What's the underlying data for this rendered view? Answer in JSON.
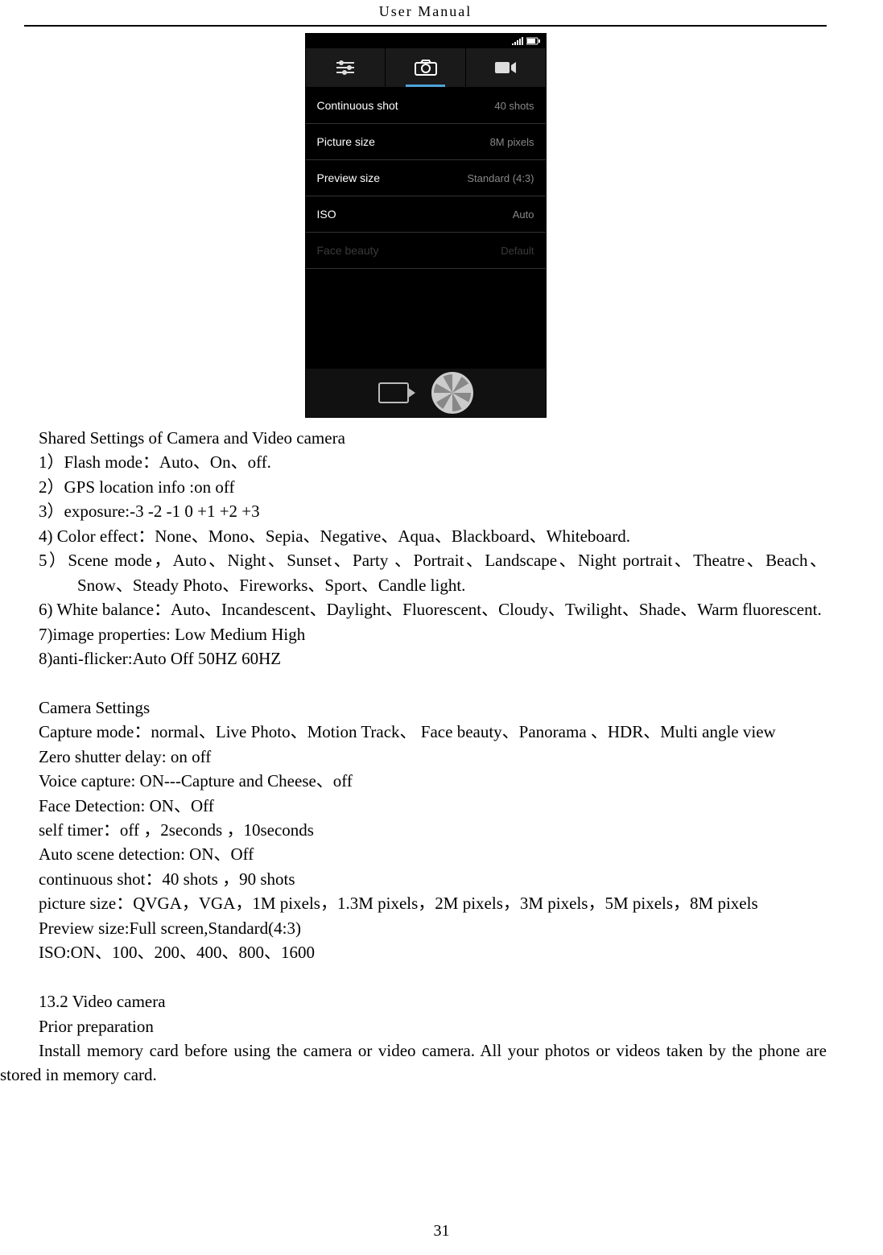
{
  "header": "User    Manual",
  "phone": {
    "tabs": {
      "active_index": 1
    },
    "rows": [
      {
        "label": "Continuous shot",
        "value": "40 shots",
        "faded": false
      },
      {
        "label": "Picture size",
        "value": "8M pixels",
        "faded": false
      },
      {
        "label": "Preview size",
        "value": "Standard (4:3)",
        "faded": false
      },
      {
        "label": "ISO",
        "value": "Auto",
        "faded": false
      },
      {
        "label": "Face beauty",
        "value": "Default",
        "faded": true
      }
    ]
  },
  "content": {
    "l1": "Shared Settings of Camera and Video camera",
    "l2": "1）Flash mode：Auto、On、off.",
    "l3": " 2）GPS location info :on      off",
    "l4": "3）exposure:-3    -2    -1    0    +1    +2    +3",
    "l5": "4)    Color effect：None、Mono、Sepia、Negative、Aqua、Blackboard、Whiteboard.",
    "l6": "5）Scene mode，Auto、Night、Sunset、Party 、Portrait、Landscape、Night portrait、Theatre、Beach、Snow、Steady Photo、Fireworks、Sport、Candle light.",
    "l7": "6) White balance：Auto、Incandescent、Daylight、Fluorescent、Cloudy、Twilight、Shade、Warm fluorescent.",
    "l8": "7)image properties: Low    Medium    High",
    "l9": "8)anti-flicker:Auto    Off    50HZ    60HZ",
    "l10": "",
    "l11": "Camera Settings",
    "l12": "Capture mode：normal、Live Photo、Motion Track、  Face beauty、Panorama    、HDR、Multi angle view",
    "l13": "Zero shutter delay: on    off",
    "l14": "Voice capture: ON---Capture and Cheese、off",
    "l15": "Face Detection: ON、Off",
    "l16": "self timer：off ，2seconds ，10seconds",
    "l17": "Auto scene detection: ON、Off",
    "l18": "continuous shot：40 shots ，90 shots",
    "l19": "picture size：QVGA，VGA，1M pixels，1.3M pixels，2M pixels，3M pixels，5M pixels，8M pixels",
    "l20": "Preview size:Full screen,Standard(4:3)",
    "l21": "ISO:ON、100、200、400、800、1600",
    "l22": "",
    "l23": "13.2    Video camera",
    "l24": "Prior preparation",
    "l25": "Install memory card before using the camera or video camera. All your photos or videos taken by the phone are stored in memory card."
  },
  "page_number": "31"
}
